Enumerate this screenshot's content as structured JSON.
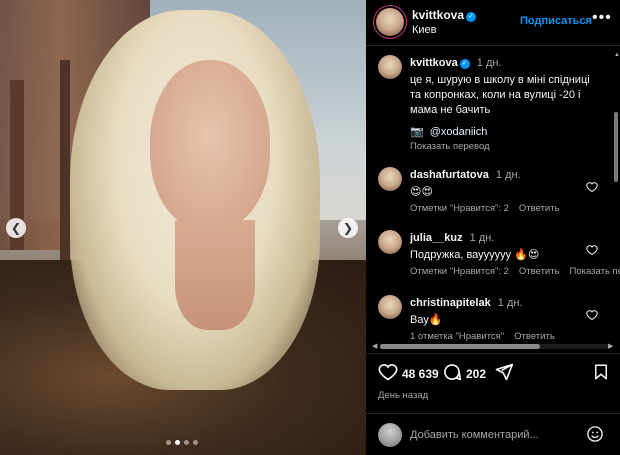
{
  "post": {
    "username": "kvittkova",
    "location": "Киев",
    "follow_label": "Подписаться",
    "more_label": "•••",
    "media_dots": 4,
    "media_active_index": 1
  },
  "caption": {
    "username": "kvittkova",
    "age": "1 дн.",
    "text": "це я, шурую в школу в міні спідниці та копронках, коли на вулиці -20 і мама не бачить",
    "credit_icon": "camera-emoji",
    "credit_mention": "@xodaniich",
    "translate_label": "Показать перевод"
  },
  "comments": [
    {
      "username": "dashafurtatova",
      "age": "1 дн.",
      "text": "😍😍",
      "likes_label": "Отметки \"Нравится\": 2",
      "reply_label": "Ответить",
      "translate_label": ""
    },
    {
      "username": "julia__kuz",
      "age": "1 дн.",
      "text": "Подружка, вауууууу 🔥😍",
      "likes_label": "Отметки \"Нравится\": 2",
      "reply_label": "Ответить",
      "translate_label": "Показать пер"
    },
    {
      "username": "christinapitelak",
      "age": "1 дн.",
      "text": "Вау🔥",
      "likes_label": "1 отметка \"Нравится\"",
      "reply_label": "Ответить",
      "translate_label": ""
    }
  ],
  "stats": {
    "likes": "48 639",
    "comments": "202",
    "posted": "День назад"
  },
  "composer": {
    "placeholder": "Добавить комментарий..."
  },
  "colors": {
    "link_blue": "#0095f6",
    "muted_text": "#a8a8a8",
    "background": "#000000",
    "divider": "#262626"
  }
}
